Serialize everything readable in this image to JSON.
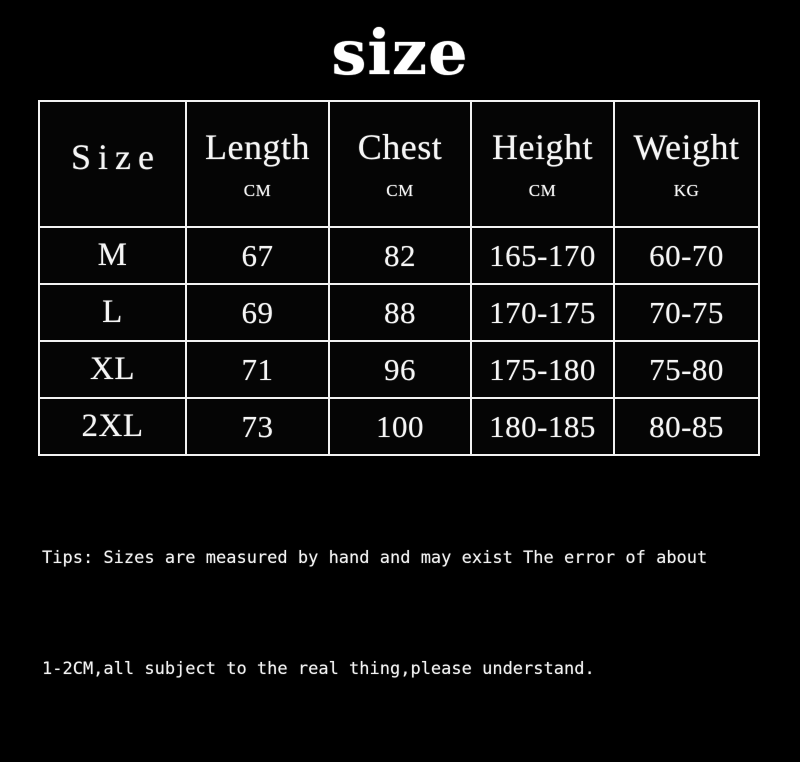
{
  "title": "size",
  "table": {
    "columns": [
      {
        "label": "Size",
        "unit": ""
      },
      {
        "label": "Length",
        "unit": "CM"
      },
      {
        "label": "Chest",
        "unit": "CM"
      },
      {
        "label": "Height",
        "unit": "CM"
      },
      {
        "label": "Weight",
        "unit": "KG"
      }
    ],
    "rows": [
      {
        "size": "M",
        "length": "67",
        "chest": "82",
        "height": "165-170",
        "weight": "60-70"
      },
      {
        "size": "L",
        "length": "69",
        "chest": "88",
        "height": "170-175",
        "weight": "70-75"
      },
      {
        "size": "XL",
        "length": "71",
        "chest": "96",
        "height": "175-180",
        "weight": "75-80"
      },
      {
        "size": "2XL",
        "length": "73",
        "chest": "100",
        "height": "180-185",
        "weight": "80-85"
      }
    ]
  },
  "tips": {
    "line1": "Tips: Sizes are measured by hand and may exist The error of about",
    "line2": "1-2CM,all subject to the real thing,please understand."
  },
  "colors": {
    "background": "#000000",
    "text": "#ffffff",
    "border": "#f2f2f2"
  }
}
